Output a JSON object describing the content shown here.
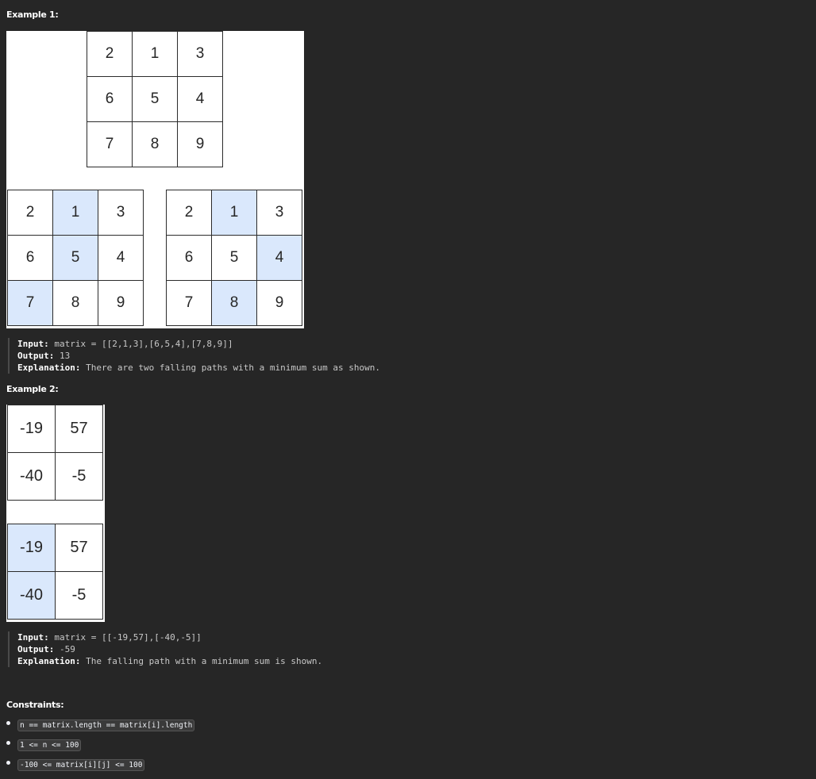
{
  "example1": {
    "heading": "Example 1:",
    "top_grid": [
      [
        "2",
        "1",
        "3"
      ],
      [
        "6",
        "5",
        "4"
      ],
      [
        "7",
        "8",
        "9"
      ]
    ],
    "left_grid": [
      [
        "2",
        "1",
        "3"
      ],
      [
        "6",
        "5",
        "4"
      ],
      [
        "7",
        "8",
        "9"
      ]
    ],
    "right_grid": [
      [
        "2",
        "1",
        "3"
      ],
      [
        "6",
        "5",
        "4"
      ],
      [
        "7",
        "8",
        "9"
      ]
    ],
    "input_label": "Input:",
    "input_value": " matrix = [[2,1,3],[6,5,4],[7,8,9]]",
    "output_label": "Output:",
    "output_value": " 13",
    "explanation_label": "Explanation:",
    "explanation_value": " There are two falling paths with a minimum sum as shown."
  },
  "example2": {
    "heading": "Example 2:",
    "top_grid": [
      [
        "-19",
        "57"
      ],
      [
        "-40",
        "-5"
      ]
    ],
    "bottom_grid": [
      [
        "-19",
        "57"
      ],
      [
        "-40",
        "-5"
      ]
    ],
    "input_label": "Input:",
    "input_value": " matrix = [[-19,57],[-40,-5]]",
    "output_label": "Output:",
    "output_value": " -59",
    "explanation_label": "Explanation:",
    "explanation_value": " The falling path with a minimum sum is shown."
  },
  "constraints": {
    "heading": "Constraints:",
    "items": [
      "n == matrix.length == matrix[i].length",
      "1 <= n <= 100",
      "-100 <= matrix[i][j] <= 100"
    ]
  },
  "colors": {
    "highlight": "#dae8fc",
    "background": "#262626"
  }
}
